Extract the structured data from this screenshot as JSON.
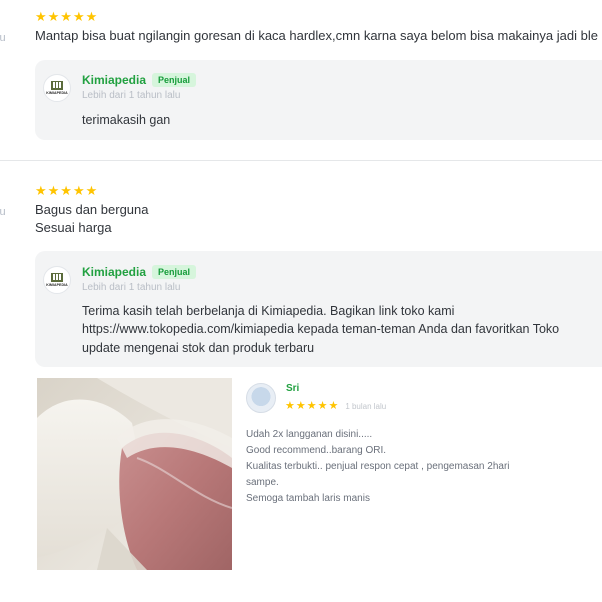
{
  "left_stub": "lu",
  "reviews": [
    {
      "stars": "★★★★★",
      "text_lines": [
        "Mantap bisa buat ngilangin goresan di kaca hardlex,cmn karna saya belom bisa makainya jadi ble"
      ],
      "reply": {
        "shop_name": "Kimiapedia",
        "shop_logo_text": "KIMIAPEDIA",
        "badge": "Penjual",
        "time": "Lebih dari 1 tahun lalu",
        "text_lines": [
          "terimakasih gan"
        ]
      }
    },
    {
      "stars": "★★★★★",
      "text_lines": [
        "Bagus dan berguna",
        "Sesuai harga"
      ],
      "reply": {
        "shop_name": "Kimiapedia",
        "shop_logo_text": "KIMIAPEDIA",
        "badge": "Penjual",
        "time": "Lebih dari 1 tahun lalu",
        "text_lines": [
          "Terima kasih telah berbelanja di Kimiapedia. Bagikan link toko kami",
          "https://www.tokopedia.com/kimiapedia kepada teman-teman Anda dan favoritkan Toko",
          "update mengenai stok dan produk terbaru"
        ]
      }
    }
  ],
  "photo_review": {
    "user_name": "Sri",
    "stars": "★★★★★",
    "time": "1 bulan lalu",
    "text_lines": [
      "Udah 2x langganan disini.....",
      "Good recommend..barang ORI.",
      "Kualitas terbukti.. penjual respon cepat , pengemasan 2hari",
      "sampe.",
      "Semoga tambah laris manis"
    ]
  }
}
